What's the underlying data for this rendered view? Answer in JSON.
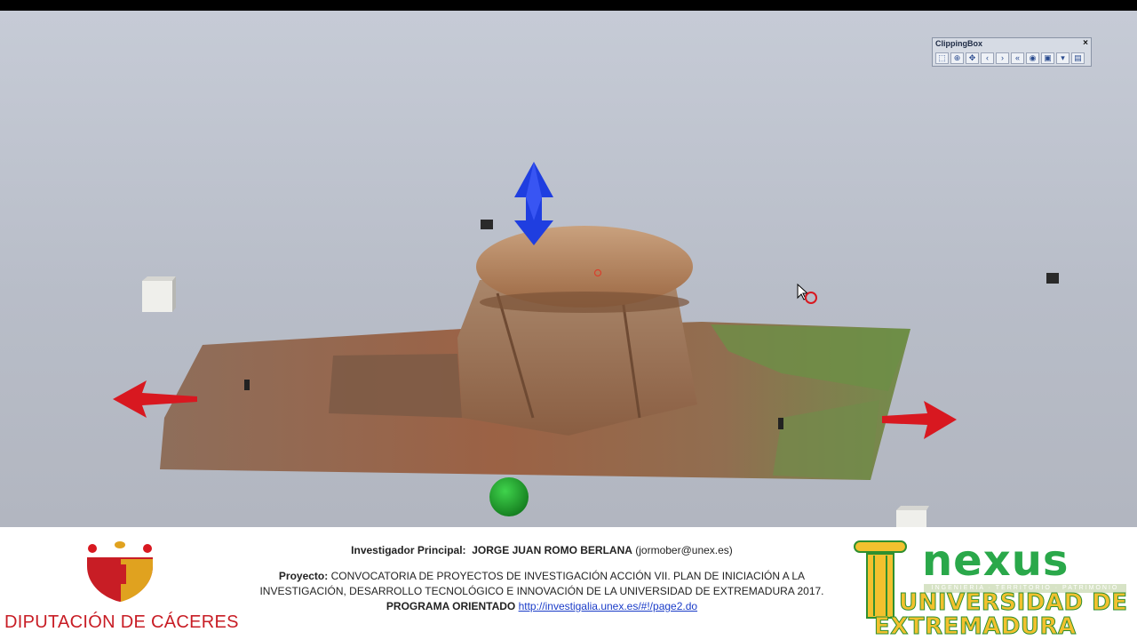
{
  "clipping_box": {
    "title": "ClippingBox",
    "close": "×",
    "tools": [
      {
        "icon": "edit-box-icon",
        "glyph": "⬚"
      },
      {
        "icon": "globe-icon",
        "glyph": "⊕"
      },
      {
        "icon": "move-icon",
        "glyph": "✥"
      },
      {
        "icon": "chevron-left-icon",
        "glyph": "‹"
      },
      {
        "icon": "chevron-right-icon",
        "glyph": "›"
      },
      {
        "icon": "double-chevron-left-icon",
        "glyph": "«"
      },
      {
        "icon": "eye-icon",
        "glyph": "◉"
      },
      {
        "icon": "display-mode-icon",
        "glyph": "▣"
      },
      {
        "icon": "dropdown-icon",
        "glyph": "▾"
      },
      {
        "icon": "export-icon",
        "glyph": "▤"
      }
    ]
  },
  "footer": {
    "diputacion_name": "DIPUTACIÓN DE CÁCERES",
    "investigator_label": "Investigador Principal:",
    "investigator_name": "JORGE JUAN ROMO BERLANA",
    "investigator_email": "(jormober@unex.es)",
    "project_label": "Proyecto:",
    "project_text": "CONVOCATORIA DE PROYECTOS DE INVESTIGACIÓN ACCIÓN VII. PLAN DE INICIACIÓN A LA INVESTIGACIÓN, DESARROLLO TECNOLÓGICO E INNOVACIÓN DE LA UNIVERSIDAD DE EXTREMADURA 2017.",
    "program_label": "PROGRAMA ORIENTADO",
    "program_link": "http://investigalia.unex.es/#!/page2.do",
    "nexus_word": "nexus",
    "nexus_sub": "INGENIERIA · TERRITORIO · PATRIMONIO",
    "uex_line1": "UNIVERSIDAD DE",
    "uex_line2": "EXTREMADURA"
  },
  "colors": {
    "arrow_red": "#d81820",
    "arrow_blue": "#1f3ee0",
    "sphere_green": "#1e9b2c",
    "diputacion_red": "#c81d25",
    "uex_yellow": "#f2c12e",
    "nexus_green": "#2aa84a"
  }
}
